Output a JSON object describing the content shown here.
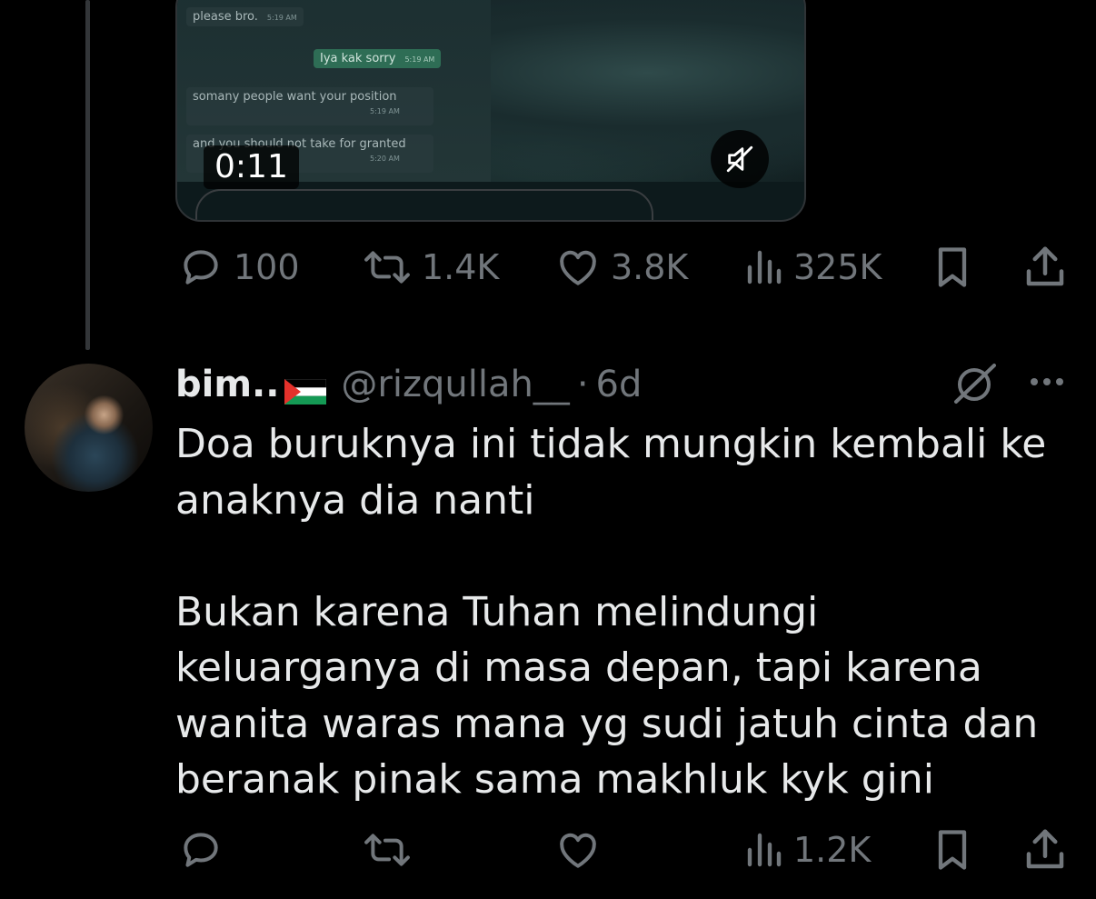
{
  "video": {
    "duration_label": "0:11",
    "chat_messages": [
      {
        "text": "please bro.",
        "time": "5:19 AM",
        "from": "other"
      },
      {
        "text": "Iya kak sorry",
        "time": "5:19 AM",
        "from": "me"
      },
      {
        "text": "somany people want your position",
        "time": "5:19 AM",
        "from": "other"
      },
      {
        "text": "and you should not take for granted",
        "time": "5:20 AM",
        "from": "other"
      }
    ],
    "mute_icon": "speaker-muted-icon"
  },
  "parent_post": {
    "actions": {
      "replies": "100",
      "reposts": "1.4K",
      "likes": "3.8K",
      "views": "325K"
    }
  },
  "reply": {
    "display_name": "bim..",
    "flag": "palestine-flag",
    "handle": "@rizqullah__",
    "separator": "·",
    "age": "6d",
    "text": "Doa buruknya ini tidak mungkin kembali ke anaknya dia nanti\n\nBukan karena Tuhan melindungi keluarganya di masa depan, tapi karena wanita waras mana yg sudi jatuh cinta dan beranak pinak sama makhluk kyk gini",
    "actions": {
      "replies": "",
      "reposts": "",
      "likes": "",
      "views": "1.2K"
    }
  },
  "colors": {
    "background": "#000000",
    "text": "#e7e9ea",
    "muted": "#71767b",
    "border": "#2f3336"
  }
}
